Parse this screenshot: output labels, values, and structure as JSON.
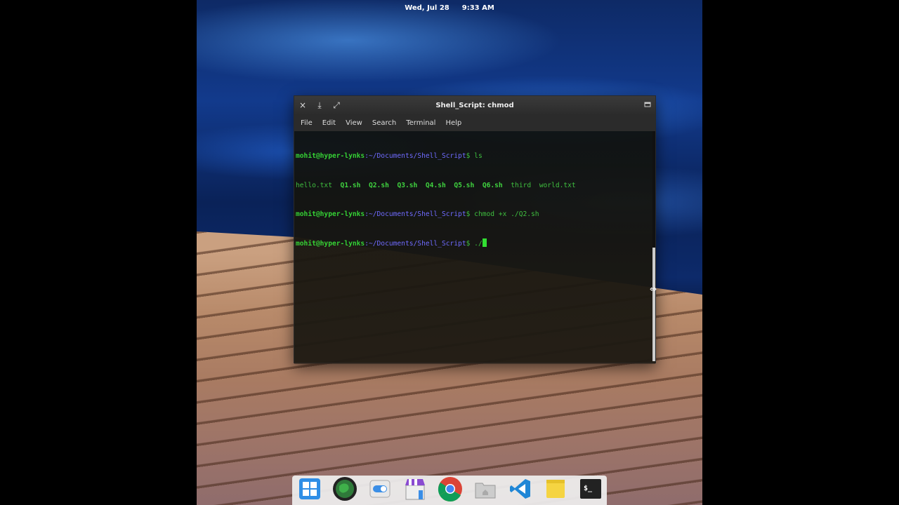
{
  "panel": {
    "date": "Wed, Jul 28",
    "time": "9:33 AM"
  },
  "window": {
    "title": "Shell_Script: chmod",
    "close_icon": "×",
    "minimize_icon": "⤓",
    "maximize_icon": "⤢",
    "menu": [
      "File",
      "Edit",
      "View",
      "Search",
      "Terminal",
      "Help"
    ]
  },
  "terminal": {
    "user_host": "mohit@hyper-lynks",
    "path": ":~/Documents/Shell_Script",
    "prompt_symbol": "$ ",
    "line1_cmd": "ls",
    "ls_output": {
      "f1": "hello.txt  ",
      "f2": "Q1.sh",
      "f3": "Q2.sh",
      "f4": "Q3.sh",
      "f5": "Q4.sh",
      "f6": "Q5.sh",
      "f7": "Q6.sh",
      "f8": "third",
      "f9": "world.txt"
    },
    "line3_cmd": "chmod +x ./Q2.sh",
    "line4_cmd": "./"
  },
  "dock": [
    "multitasking-view-icon",
    "browser-globe-icon",
    "settings-toggle-icon",
    "app-center-icon",
    "chrome-icon",
    "files-icon",
    "vscode-icon",
    "notes-icon",
    "terminal-icon"
  ],
  "colors": {
    "prompt_user": "#35d235",
    "prompt_path": "#6f6bff",
    "text": "#3fbf3f",
    "cursor": "#32e032"
  }
}
